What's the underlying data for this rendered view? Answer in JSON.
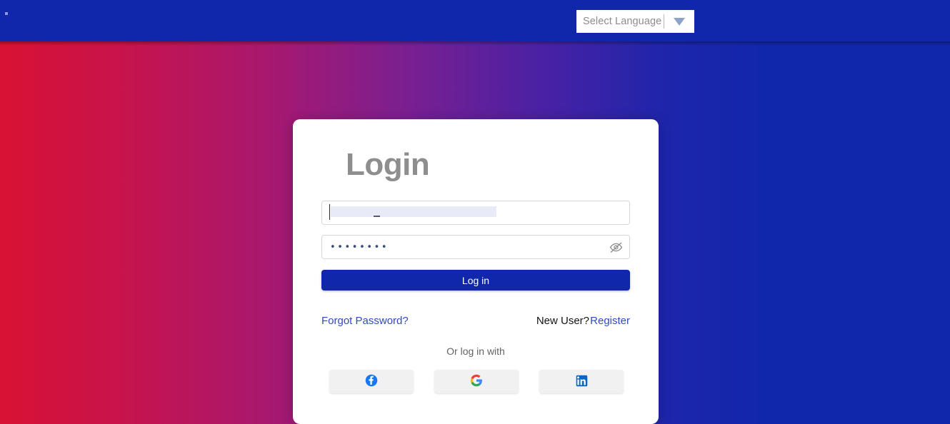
{
  "topbar": {
    "language_selector": {
      "label": "Select Language",
      "arrow_icon": "chevron-down-icon"
    }
  },
  "card": {
    "title": "Login",
    "username_field": {
      "value": "",
      "placeholder": ""
    },
    "password_field": {
      "value": "••••••••",
      "placeholder": "",
      "toggle_icon": "eye-off-icon"
    },
    "login_button": "Log in",
    "forgot_password_link": "Forgot Password?",
    "new_user_text": "New User?",
    "register_link": "Register",
    "social_divider_text": "Or log in with",
    "social_buttons": [
      {
        "name": "facebook",
        "icon": "facebook-icon"
      },
      {
        "name": "google",
        "icon": "google-icon"
      },
      {
        "name": "linkedin",
        "icon": "linkedin-icon"
      }
    ]
  },
  "colors": {
    "brand_blue": "#1127ab",
    "gradient_start": "#d81234",
    "gradient_mid": "#7d1f8f",
    "gradient_end": "#1127ab",
    "link_blue": "#2f4bc4",
    "title_gray": "#8e8e8e",
    "facebook_blue": "#1877f2",
    "linkedin_blue": "#0a66c2",
    "google_blue": "#4285f4",
    "google_red": "#ea4335",
    "google_yellow": "#fbbc05",
    "google_green": "#34a853"
  }
}
